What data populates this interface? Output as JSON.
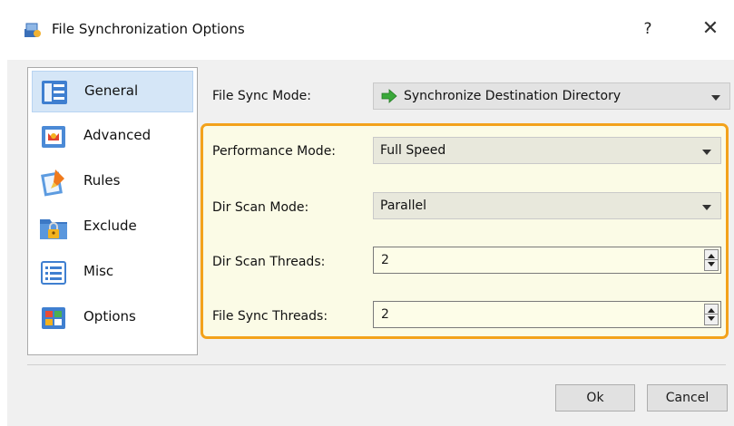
{
  "window": {
    "title": "File Synchronization Options",
    "help_label": "?",
    "close_label": "✕"
  },
  "sidebar": {
    "items": [
      {
        "label": "General",
        "icon": "general-icon",
        "selected": true
      },
      {
        "label": "Advanced",
        "icon": "advanced-icon"
      },
      {
        "label": "Rules",
        "icon": "rules-icon"
      },
      {
        "label": "Exclude",
        "icon": "exclude-lock-icon"
      },
      {
        "label": "Misc",
        "icon": "misc-list-icon"
      },
      {
        "label": "Options",
        "icon": "options-icon"
      }
    ]
  },
  "form": {
    "sync_mode_label": "File Sync Mode:",
    "sync_mode_value": "Synchronize Destination Directory",
    "performance_label": "Performance Mode:",
    "performance_value": "Full Speed",
    "dir_scan_mode_label": "Dir Scan Mode:",
    "dir_scan_mode_value": "Parallel",
    "dir_scan_threads_label": "Dir Scan Threads:",
    "dir_scan_threads_value": "2",
    "file_sync_threads_label": "File Sync Threads:",
    "file_sync_threads_value": "2"
  },
  "buttons": {
    "ok_label": "Ok",
    "cancel_label": "Cancel"
  },
  "colors": {
    "highlight_border": "#f3a21b",
    "selected_item": "#d5e6f7"
  }
}
